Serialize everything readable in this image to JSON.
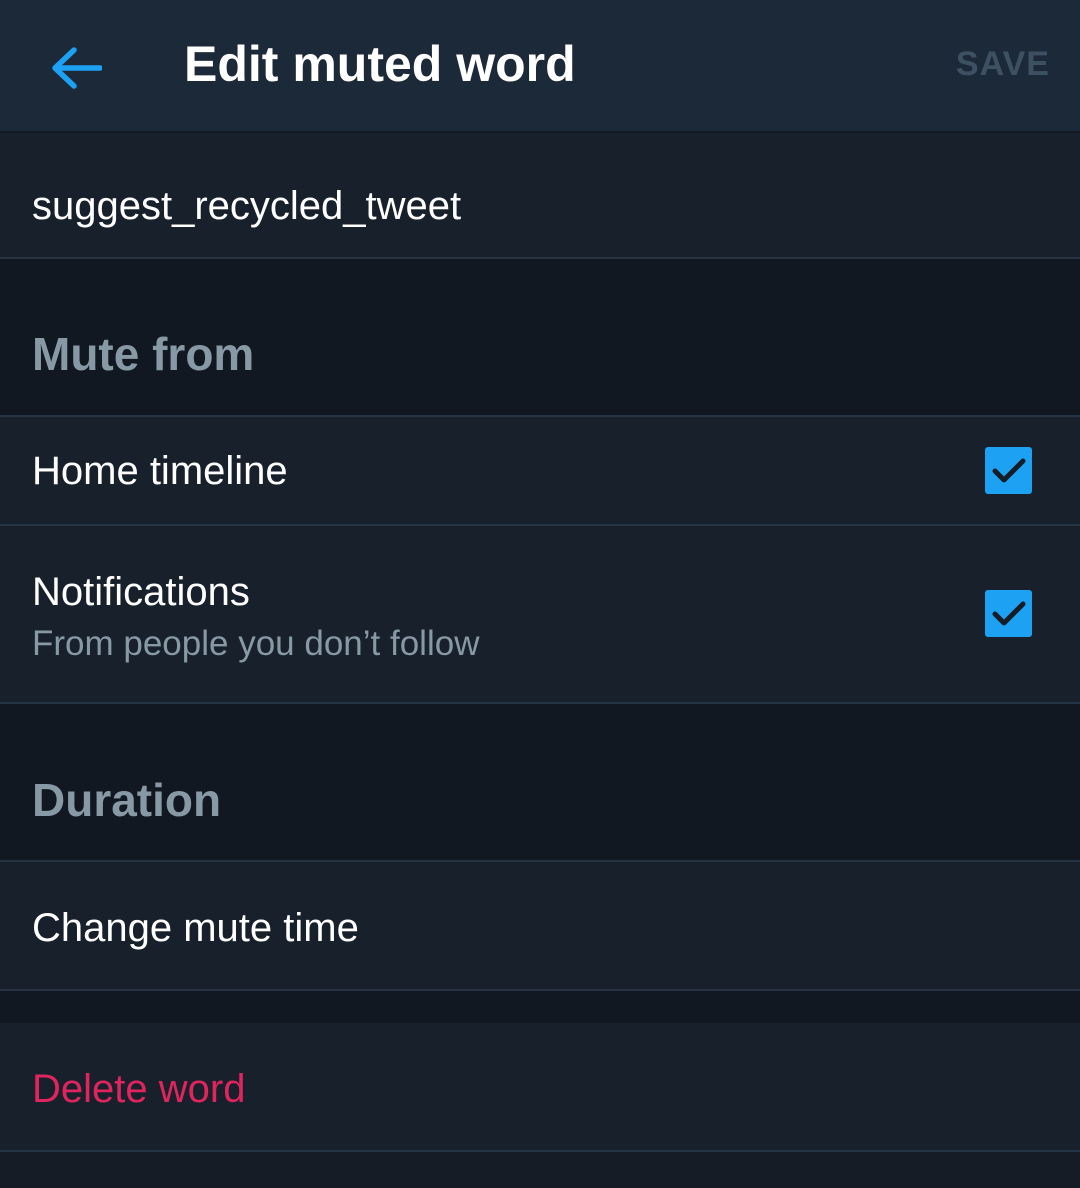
{
  "header": {
    "title": "Edit muted word",
    "save_label": "SAVE",
    "back_icon": "arrow-left-icon",
    "accent_color": "#1da1f2"
  },
  "word": {
    "value": "suggest_recycled_tweet"
  },
  "mute_from": {
    "title": "Mute from",
    "options": [
      {
        "label": "Home timeline",
        "checked": true
      },
      {
        "label": "Notifications",
        "sublabel": "From people you don’t follow",
        "checked": true
      }
    ]
  },
  "duration": {
    "title": "Duration",
    "change_label": "Change mute time"
  },
  "delete": {
    "label": "Delete word",
    "color": "#e0245e"
  }
}
